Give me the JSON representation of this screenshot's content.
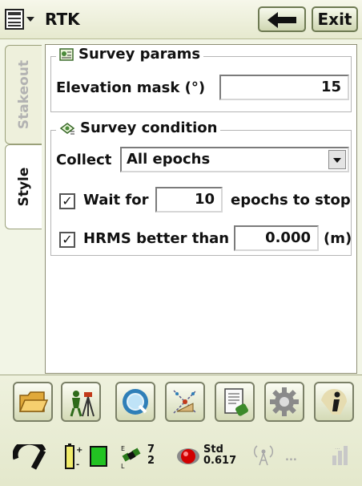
{
  "window": {
    "title": "RTK",
    "exit_label": "Exit"
  },
  "tabs": [
    {
      "label": "Stakeout",
      "active": false
    },
    {
      "label": "Style",
      "active": true
    }
  ],
  "survey_params": {
    "legend": "Survey params",
    "elevation_mask_label": "Elevation mask (°)",
    "elevation_mask_value": "15"
  },
  "survey_condition": {
    "legend": "Survey condition",
    "collect_label": "Collect",
    "collect_value": "All epochs",
    "wait_for_checked": true,
    "wait_for_label": "Wait for",
    "wait_for_value": "10",
    "wait_for_suffix": "epochs to stop",
    "hrms_checked": true,
    "hrms_label": "HRMS better than",
    "hrms_value": "0.000",
    "hrms_unit": "(m)"
  },
  "toolbar": {
    "icons": [
      "folder-icon",
      "survey-tripod-icon",
      "search-icon",
      "coordinate-system-icon",
      "document-icon",
      "gear-icon",
      "info-icon"
    ]
  },
  "status": {
    "sat_top": "7",
    "sat_bottom": "2",
    "solution_label": "Std",
    "solution_value": "0.617",
    "radio_text": "..."
  },
  "colors": {
    "accent": "#6e7a53",
    "battery": "#22c322",
    "fix_status": "#d10000"
  }
}
